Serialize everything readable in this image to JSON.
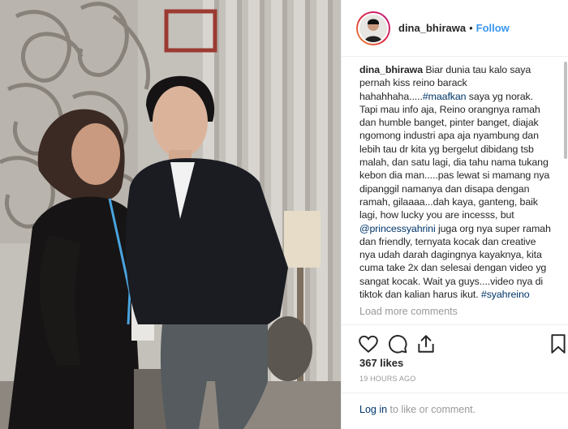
{
  "post": {
    "username": "dina_bhirawa",
    "separator": "•",
    "follow_label": "Follow",
    "caption_parts": [
      {
        "kind": "user",
        "text": "dina_bhirawa"
      },
      {
        "kind": "text",
        "text": " Biar dunia tau kalo saya pernah kiss reino barack hahahhaha....."
      },
      {
        "kind": "tag",
        "text": "#maafkan"
      },
      {
        "kind": "text",
        "text": " saya yg norak. Tapi mau info aja, Reino orangnya ramah dan humble banget, pinter banget, diajak ngomong industri apa aja nyambung dan lebih tau dr kita yg bergelut dibidang tsb malah, dan satu lagi, dia tahu nama tukang kebon dia man.....pas lewat si mamang nya dipanggil namanya dan disapa dengan ramah, gilaaaa...dah kaya, ganteng, baik lagi, how lucky you are incesss, but "
      },
      {
        "kind": "tag",
        "text": "@princessyahrini"
      },
      {
        "kind": "text",
        "text": " juga org nya super ramah dan friendly, ternyata kocak dan creative nya udah darah dagingnya kayaknya, kita cuma take 2x dan selesai dengan video yg sangat kocak. Wait ya guys....video nya di tiktok dan kalian harus ikut. "
      },
      {
        "kind": "tag",
        "text": "#syahreino"
      }
    ],
    "load_more_label": "Load more comments",
    "likes": "367 likes",
    "timestamp": "19 HOURS AGO",
    "login_link": "Log in",
    "login_suffix": " to like or comment."
  },
  "icons": {
    "like": "heart-icon",
    "comment": "comment-icon",
    "share": "share-icon",
    "save": "bookmark-icon"
  },
  "colors": {
    "link": "#003569",
    "follow": "#3897f0",
    "muted": "#999999"
  }
}
